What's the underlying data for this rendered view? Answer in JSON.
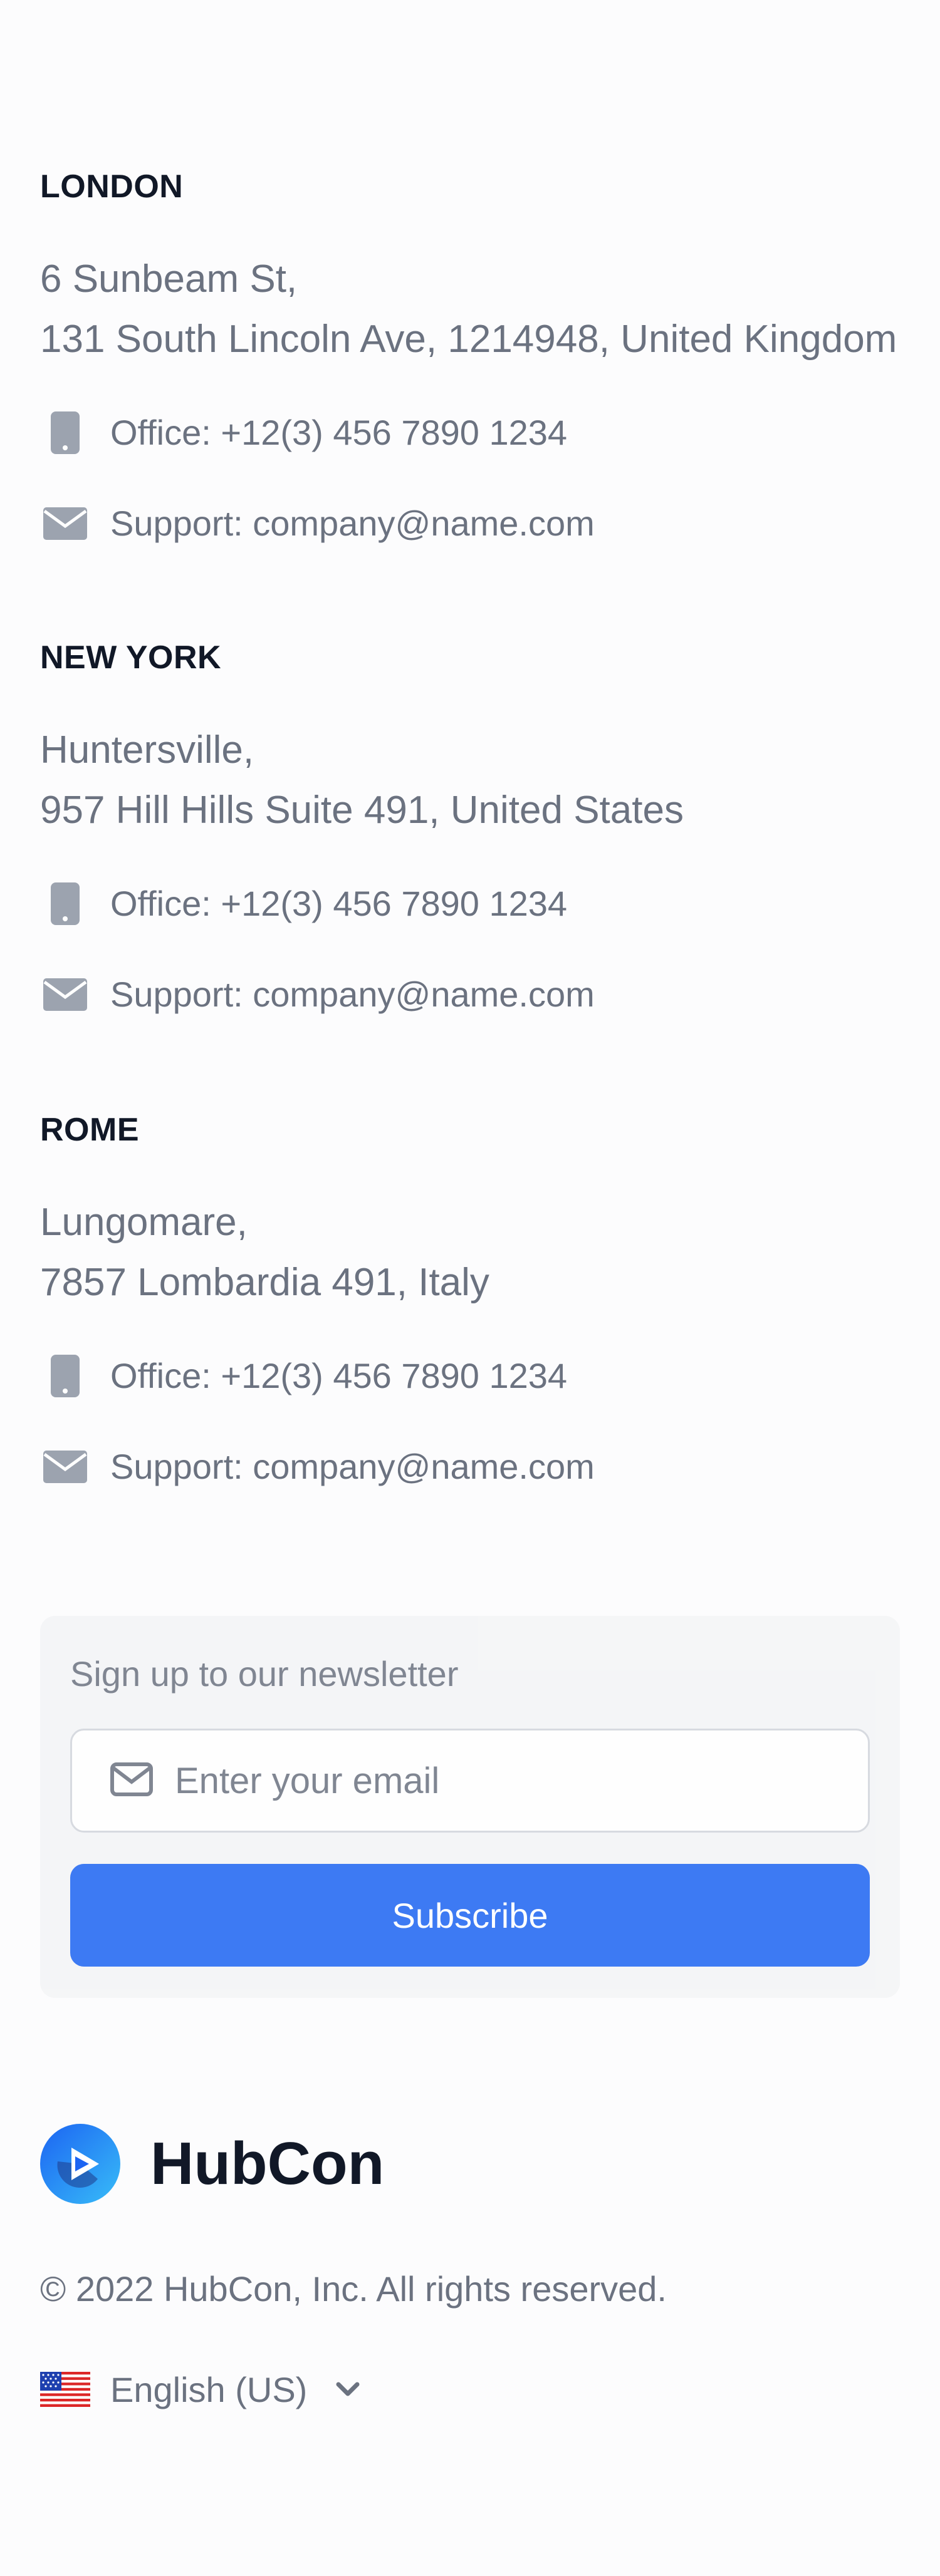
{
  "offices": [
    {
      "city": "LONDON",
      "address_line1": "6 Sunbeam St,",
      "address_line2": "131 South Lincoln Ave, 1214948, United Kingdom",
      "phone": "Office: +12(3) 456 7890 1234",
      "email": "Support: company@name.com"
    },
    {
      "city": "NEW YORK",
      "address_line1": "Huntersville,",
      "address_line2": "957 Hill Hills Suite 491, United States",
      "phone": "Office: +12(3) 456 7890 1234",
      "email": "Support: company@name.com"
    },
    {
      "city": "ROME",
      "address_line1": "Lungomare,",
      "address_line2": "7857 Lombardia 491, Italy",
      "phone": "Office: +12(3) 456 7890 1234",
      "email": "Support: company@name.com"
    }
  ],
  "newsletter": {
    "title": "Sign up to our newsletter",
    "email_placeholder": "Enter your email",
    "subscribe_label": "Subscribe"
  },
  "brand": {
    "name": "HubCon"
  },
  "footer": {
    "copyright": "© 2022 HubCon, Inc. All rights reserved.",
    "language": "English (US)"
  },
  "colors": {
    "accent": "#1c64f2",
    "heading": "#111827",
    "muted": "#6b7280",
    "icon": "#9ca3af"
  },
  "icons": {
    "phone": "mobile-phone-icon",
    "email": "envelope-icon",
    "flag": "us-flag-icon",
    "chevron": "chevron-down-icon"
  }
}
